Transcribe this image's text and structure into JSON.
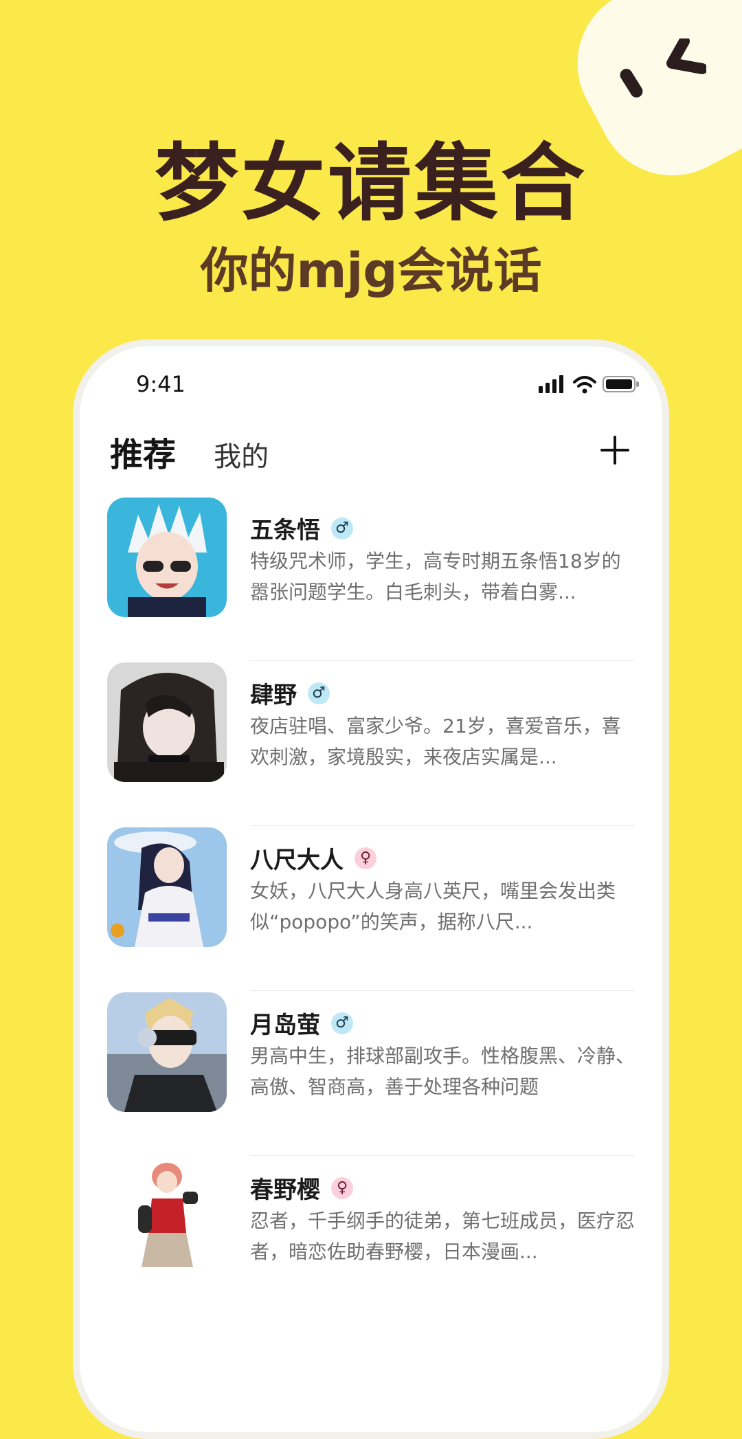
{
  "colors": {
    "background": "#fbe94a",
    "title": "#3a2120",
    "subtitle": "#5b3a26"
  },
  "hero": {
    "title": "梦女请集合",
    "subtitle": "你的mjg会说话"
  },
  "phone": {
    "status": {
      "time": "9:41",
      "icons": [
        "signal-icon",
        "wifi-icon",
        "battery-icon"
      ]
    },
    "tabs": {
      "recommended": "推荐",
      "mine": "我的"
    },
    "add_icon": "plus-icon",
    "characters": [
      {
        "name": "五条悟",
        "gender": "male",
        "gender_icon": "male-icon",
        "desc": "特级咒术师，学生，高专时期五条悟18岁的嚣张问题学生。白毛刺头，带着白雾..."
      },
      {
        "name": "肆野",
        "gender": "male",
        "gender_icon": "male-icon",
        "desc": "夜店驻唱、富家少爷。21岁，喜爱音乐，喜欢刺激，家境殷实，来夜店实属是..."
      },
      {
        "name": "八尺大人",
        "gender": "female",
        "gender_icon": "female-icon",
        "desc": "女妖，八尺大人身高八英尺，嘴里会发出类似“popopo”的笑声，据称八尺..."
      },
      {
        "name": "月岛萤",
        "gender": "male",
        "gender_icon": "male-icon",
        "desc": "男高中生，排球部副攻手。性格腹黑、冷静、高傲、智商高，善于处理各种问题"
      },
      {
        "name": "春野樱",
        "gender": "female",
        "gender_icon": "female-icon",
        "desc": "忍者，千手纲手的徒弟，第七班成员，医疗忍者，暗恋佐助春野樱，日本漫画..."
      }
    ]
  }
}
